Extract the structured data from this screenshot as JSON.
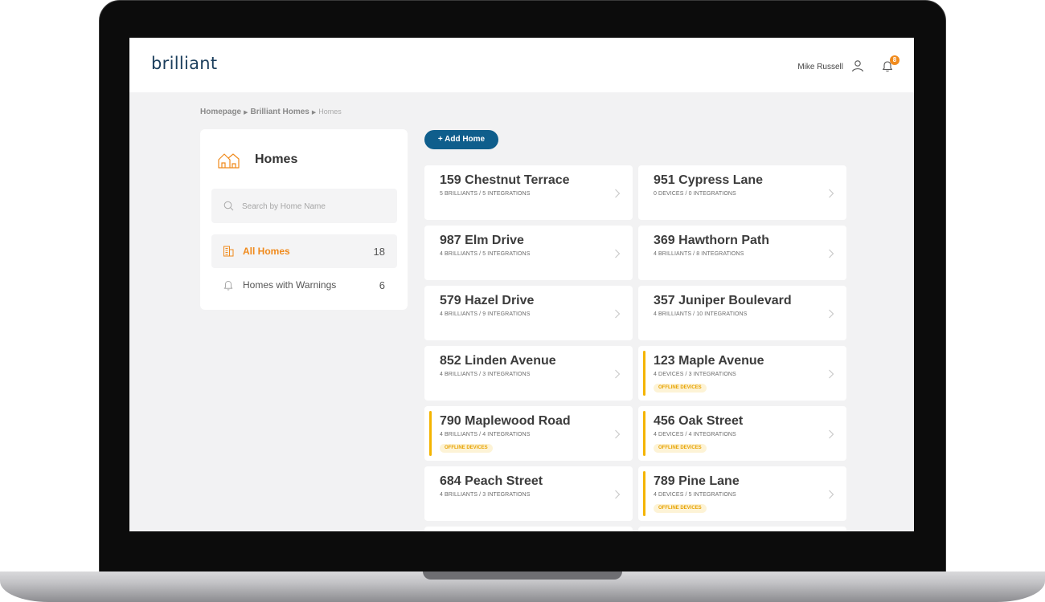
{
  "app": {
    "logo": "brilliant"
  },
  "header": {
    "user_name": "Mike Russell",
    "notification_count": "8"
  },
  "breadcrumb": {
    "items": [
      "Homepage",
      "Brilliant Homes",
      "Homes"
    ]
  },
  "sidebar": {
    "title": "Homes",
    "search_placeholder": "Search by Home Name",
    "nav": [
      {
        "label": "All Homes",
        "count": "18",
        "active": true
      },
      {
        "label": "Homes with Warnings",
        "count": "6",
        "active": false
      }
    ]
  },
  "actions": {
    "add_home_label": "+ Add Home"
  },
  "homes": [
    {
      "name": "159 Chestnut Terrace",
      "subtitle": "5 BRILLIANTS / 5 INTEGRATIONS",
      "warning": ""
    },
    {
      "name": "951 Cypress Lane",
      "subtitle": "0 DEVICES / 0 INTEGRATIONS",
      "warning": ""
    },
    {
      "name": "987 Elm Drive",
      "subtitle": "4 BRILLIANTS / 5 INTEGRATIONS",
      "warning": ""
    },
    {
      "name": "369 Hawthorn Path",
      "subtitle": "4 BRILLIANTS / 8 INTEGRATIONS",
      "warning": ""
    },
    {
      "name": "579 Hazel Drive",
      "subtitle": "4 BRILLIANTS / 9 INTEGRATIONS",
      "warning": ""
    },
    {
      "name": "357 Juniper Boulevard",
      "subtitle": "4 BRILLIANTS / 10 INTEGRATIONS",
      "warning": ""
    },
    {
      "name": "852 Linden Avenue",
      "subtitle": "4 BRILLIANTS / 3 INTEGRATIONS",
      "warning": ""
    },
    {
      "name": "123 Maple Avenue",
      "subtitle": "4 DEVICES / 3 INTEGRATIONS",
      "warning": "OFFLINE DEVICES"
    },
    {
      "name": "790 Maplewood Road",
      "subtitle": "4 BRILLIANTS / 4 INTEGRATIONS",
      "warning": "OFFLINE DEVICES"
    },
    {
      "name": "456 Oak Street",
      "subtitle": "4 DEVICES / 4 INTEGRATIONS",
      "warning": "OFFLINE DEVICES"
    },
    {
      "name": "684 Peach Street",
      "subtitle": "4 BRILLIANTS / 3 INTEGRATIONS",
      "warning": ""
    },
    {
      "name": "789 Pine Lane",
      "subtitle": "4 DEVICES / 5 INTEGRATIONS",
      "warning": "OFFLINE DEVICES"
    },
    {
      "name": "",
      "subtitle": "",
      "warning": ""
    },
    {
      "name": "",
      "subtitle": "",
      "warning": ""
    }
  ],
  "colors": {
    "brand_blue": "#0f5e8c",
    "accent_orange": "#f08a1c",
    "warning_yellow": "#f4b400",
    "background": "#f2f2f3"
  }
}
